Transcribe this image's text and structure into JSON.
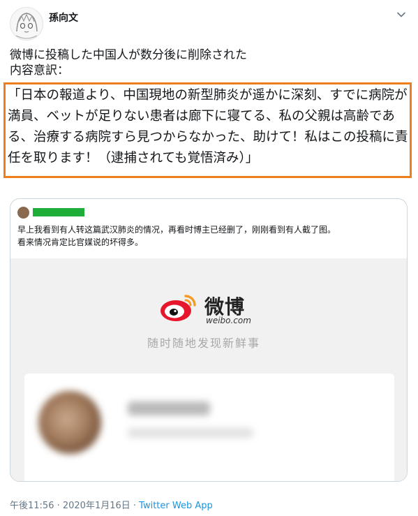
{
  "author": {
    "name": "孫向文"
  },
  "tweet": {
    "line1": "微博に投稿した中国人が数分後に削除された",
    "line2": "内容意訳：",
    "quote": "「日本の報道より、中国現地の新型肺炎が遥かに深刻、すでに病院が満員、ベットが足りない患者は廊下に寝てる、私の父親は高齢である、治療する病院すら見つからなかった、助けて！私はこの投稿に責任を取ります！（逮捕されても覚悟済み）」"
  },
  "quoted_tweet": {
    "line1": "早上我看到有人转这篇武汉肺炎的情况，再看时博主已经删了，刚刚看到有人截了图。",
    "line2": "看来情况肯定比官媒说的坏得多。",
    "weibo_brand": "微博",
    "weibo_domain": "weibo.com",
    "weibo_slogan": "随时随地发现新鲜事"
  },
  "meta": {
    "time_date": "午後11:56 · 2020年1月16日 · ",
    "source": "Twitter Web App"
  },
  "colors": {
    "highlight": "#ee7d1c",
    "redaction": "#1fae3a",
    "link": "#1b95e0"
  },
  "icons": {
    "menu": "chevron-down-icon",
    "weibo": "weibo-logo-icon"
  }
}
